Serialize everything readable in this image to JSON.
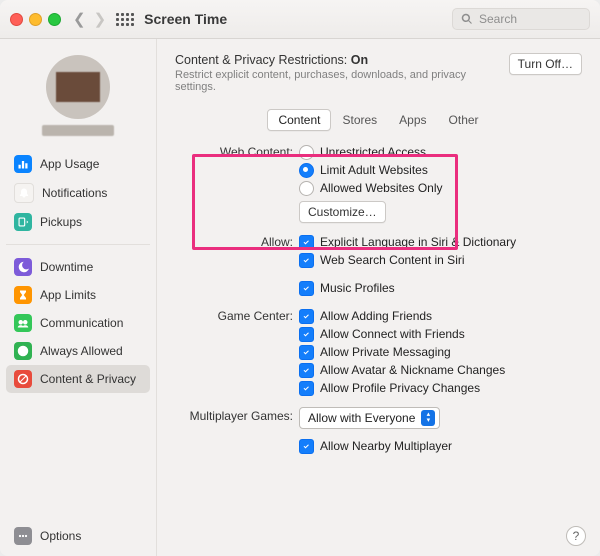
{
  "title": "Screen Time",
  "search_placeholder": "Search",
  "turn_off_label": "Turn Off…",
  "header": {
    "line": "Content & Privacy Restrictions:",
    "state": "On",
    "sub": "Restrict explicit content, purchases, downloads, and privacy settings."
  },
  "tabs": {
    "content": "Content",
    "stores": "Stores",
    "apps": "Apps",
    "other": "Other"
  },
  "labels": {
    "web_content": "Web Content:",
    "allow": "Allow:",
    "game_center": "Game Center:",
    "multiplayer": "Multiplayer Games:"
  },
  "web_content": {
    "unrestricted": "Unrestricted Access",
    "limit_adult": "Limit Adult Websites",
    "allowed_only": "Allowed Websites Only",
    "customize": "Customize…"
  },
  "allow": {
    "explicit_lang": "Explicit Language in Siri & Dictionary",
    "web_search": "Web Search Content in Siri",
    "music": "Music Profiles"
  },
  "game_center": {
    "add_friends": "Allow Adding Friends",
    "connect_friends": "Allow Connect with Friends",
    "private_msg": "Allow Private Messaging",
    "avatar": "Allow Avatar & Nickname Changes",
    "privacy": "Allow Profile Privacy Changes"
  },
  "multiplayer": {
    "selected": "Allow with Everyone",
    "nearby": "Allow Nearby Multiplayer"
  },
  "sidebar": {
    "app_usage": "App Usage",
    "notifications": "Notifications",
    "pickups": "Pickups",
    "downtime": "Downtime",
    "app_limits": "App Limits",
    "communication": "Communication",
    "always_allowed": "Always Allowed",
    "content_privacy": "Content & Privacy",
    "options": "Options"
  }
}
